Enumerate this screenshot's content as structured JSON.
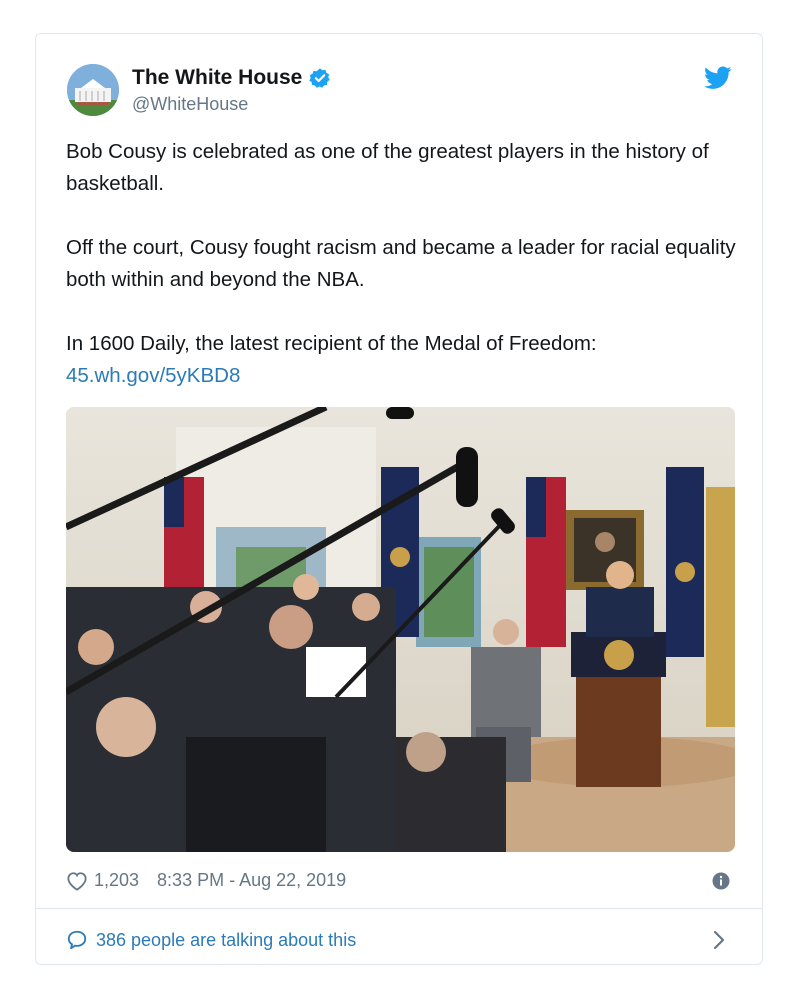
{
  "account": {
    "name": "The White House",
    "handle": "@WhiteHouse",
    "avatar_icon": "white-house-building-icon",
    "verified_icon": "verified-badge-icon"
  },
  "tweet": {
    "paragraph1": "Bob Cousy is celebrated as one of the greatest players in the history of basketball.",
    "paragraph2": "Off the court, Cousy fought racism and became a leader for racial equality both within and beyond the NBA.",
    "paragraph3": "In 1600 Daily, the latest recipient of the Medal of Freedom:",
    "link": "45.wh.gov/5yKBD8"
  },
  "footer": {
    "likes": "1,203",
    "timestamp": "8:33 PM - Aug 22, 2019",
    "talking": "386 people are talking about this"
  },
  "colors": {
    "link": "#2b7bb9",
    "twitter_blue": "#1da1f2",
    "muted": "#657786",
    "border": "#e1e8ed"
  }
}
